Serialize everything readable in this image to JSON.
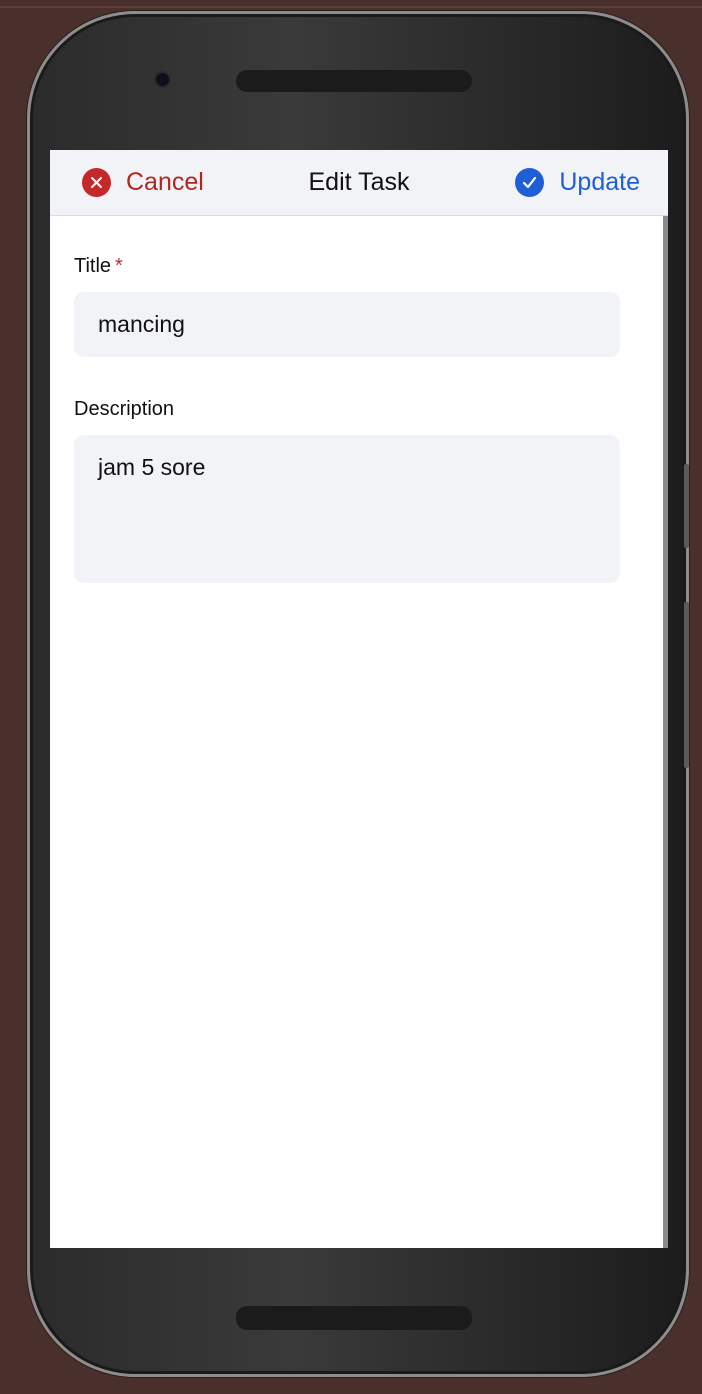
{
  "header": {
    "cancel_label": "Cancel",
    "title": "Edit Task",
    "update_label": "Update",
    "cancel_icon": "close-circle-icon",
    "update_icon": "check-circle-icon"
  },
  "form": {
    "title_label": "Title",
    "required_marker": "*",
    "title_value": "mancing",
    "description_label": "Description",
    "description_value": "jam 5 sore"
  },
  "colors": {
    "cancel": "#c4282a",
    "update": "#1f5fd6",
    "field_background": "#f2f3f7"
  }
}
